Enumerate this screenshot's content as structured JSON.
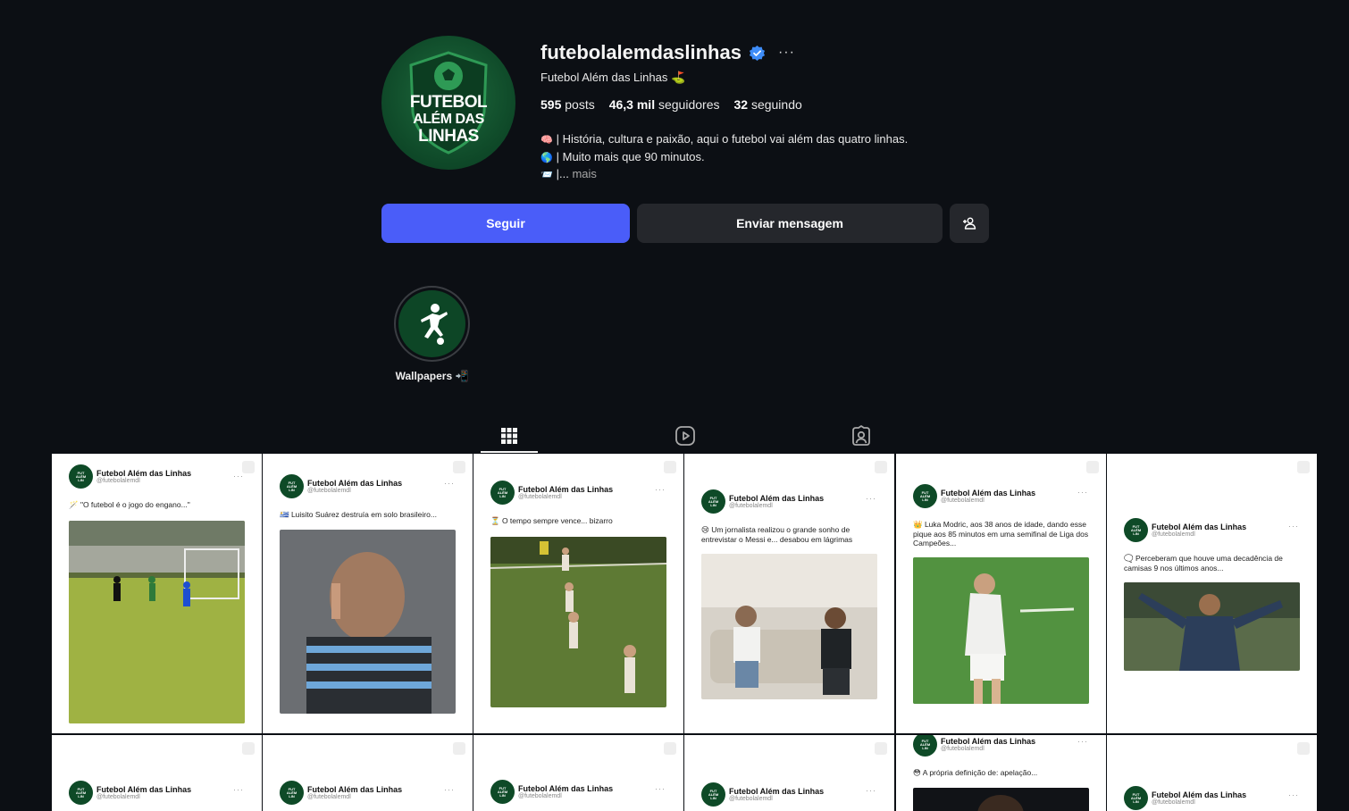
{
  "profile": {
    "username": "futebolalemdaslinhas",
    "full_name": "Futebol Além das Linhas ⛳",
    "logo_text": [
      "FUTEBOL",
      "ALÉM DAS",
      "LINHAS"
    ],
    "stats": {
      "posts_count": "595",
      "posts_label": "posts",
      "followers_count": "46,3 mil",
      "followers_label": "seguidores",
      "following_count": "32",
      "following_label": "seguindo"
    },
    "bio": [
      {
        "emoji": "🧠",
        "text": "| História, cultura e paixão, aqui o futebol vai além das quatro linhas."
      },
      {
        "emoji": "🌎",
        "text": "| Muito mais que 90 minutos."
      },
      {
        "emoji": "📨",
        "text": "|..."
      }
    ],
    "bio_more": "mais"
  },
  "buttons": {
    "follow": "Seguir",
    "message": "Enviar mensagem"
  },
  "highlight": {
    "label": "Wallpapers 📲"
  },
  "tweet_author": {
    "name": "Futebol Além das Linhas",
    "handle": "@futebolalemdl"
  },
  "posts": [
    {
      "text": "🪄 \"O futebol é o jogo do engano...\""
    },
    {
      "text": "🇺🇾 Luisito Suárez destruía em solo brasileiro..."
    },
    {
      "text": "⏳ O tempo sempre vence... bizarro"
    },
    {
      "text": "😢 Um jornalista realizou o grande sonho de entrevistar o Messi e... desabou em lágrimas"
    },
    {
      "text": "👑 Luka Modric, aos 38 anos de idade, dando esse pique aos 85 minutos em uma semifinal de Liga dos Campeões..."
    },
    {
      "text": "🗨️ Perceberam que houve uma decadência de camisas 9 nos últimos anos..."
    },
    {
      "text": ""
    },
    {
      "text": ""
    },
    {
      "text": ""
    },
    {
      "text": ""
    },
    {
      "text": "😳 A própria definição de: apelação..."
    },
    {
      "text": ""
    }
  ],
  "colors": {
    "background": "#0c0f14",
    "follow_button": "#4a5df9",
    "secondary_button": "#25272c",
    "verified_badge": "#3e8cf7",
    "brand_green": "#0e4a27"
  },
  "icons": {
    "verified": "verified-badge-icon",
    "more": "more-options-icon",
    "add_person": "add-person-icon",
    "posts_tab": "grid-icon",
    "reels_tab": "reels-icon",
    "tagged_tab": "tagged-icon"
  }
}
